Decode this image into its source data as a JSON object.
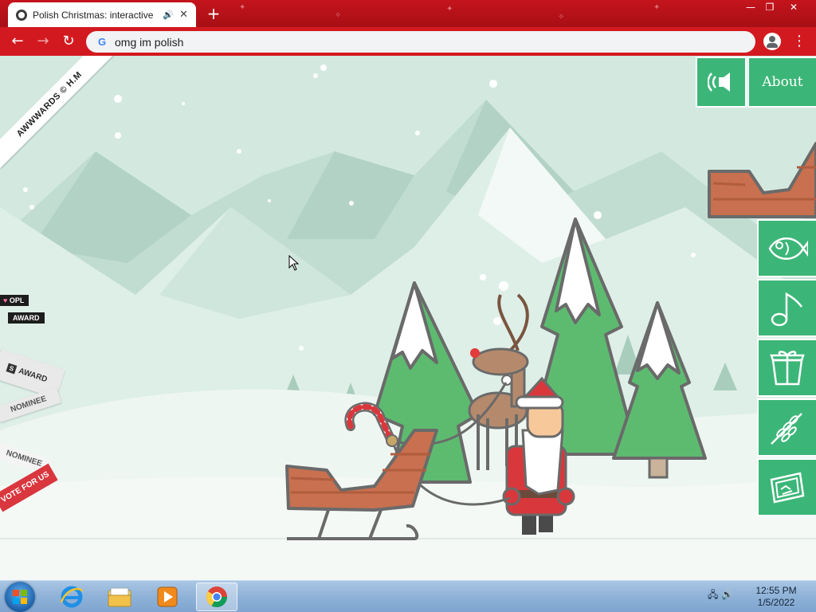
{
  "browser": {
    "tab": {
      "title": "Polish Christmas: interactive",
      "audio_icon": "speaker-icon",
      "close_glyph": "✕"
    },
    "new_tab_glyph": "+",
    "window_controls": {
      "minimize": "—",
      "restore": "❐",
      "close": "✕"
    },
    "toolbar": {
      "back_glyph": "←",
      "forward_glyph": "→",
      "reload_glyph": "↻",
      "omnibox_text": "omg im polish",
      "search_engine_icon": "G",
      "menu_glyph": "⋮"
    }
  },
  "page": {
    "awwwards_badge": "AWWWARDS © H.M",
    "opl_award": {
      "line1": "OPL",
      "line2": "AWARD",
      "heart": "♥"
    },
    "css_award": {
      "logo": "S",
      "label": "AWARD",
      "nominee": "NOMINEE"
    },
    "nominee_badge": "NOMINEE",
    "vote_badge": "VOTE FOR US",
    "header": {
      "sound_icon": "sound-on-icon",
      "about_label": "About"
    },
    "side_menu": [
      {
        "name": "fish-icon"
      },
      {
        "name": "music-note-icon"
      },
      {
        "name": "gift-icon"
      },
      {
        "name": "wheat-icon"
      },
      {
        "name": "ticket-icon"
      }
    ]
  },
  "taskbar": {
    "apps": [
      "internet-explorer-icon",
      "file-explorer-icon",
      "media-player-icon",
      "chrome-icon"
    ],
    "clock": {
      "time": "12:55 PM",
      "date": "1/5/2022"
    }
  },
  "colors": {
    "chrome_red": "#d31920",
    "menu_green": "#3cb678",
    "sky": "#d7ece4",
    "tree_green": "#55b86c",
    "sled_wood": "#c8704f"
  }
}
